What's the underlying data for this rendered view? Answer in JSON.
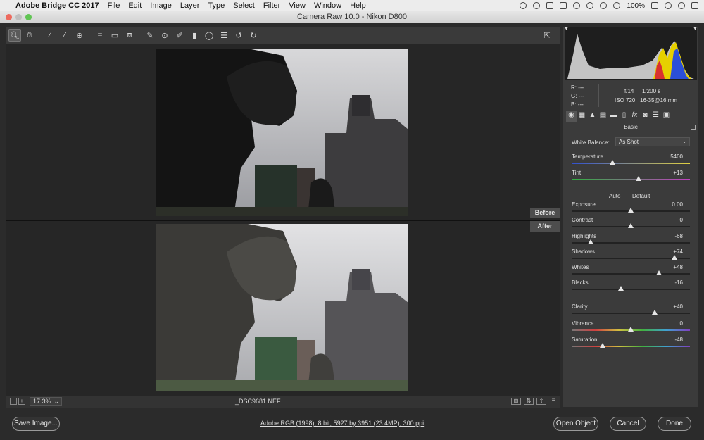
{
  "menubar": {
    "app_name": "Adobe Bridge CC 2017",
    "items": [
      "File",
      "Edit",
      "Image",
      "Layer",
      "Type",
      "Select",
      "Filter",
      "View",
      "Window",
      "Help"
    ],
    "battery": "100%"
  },
  "window": {
    "title": "Camera Raw 10.0  -  Nikon D800"
  },
  "preview": {
    "before_label": "Before",
    "after_label": "After"
  },
  "status": {
    "zoom": "17.3%",
    "filename": "_DSC9681.NEF"
  },
  "footer": {
    "save_label": "Save Image...",
    "workflow_link": "Adobe RGB (1998); 8 bit; 5927 by 3951 (23.4MP); 300 ppi",
    "open_label": "Open Object",
    "cancel_label": "Cancel",
    "done_label": "Done"
  },
  "info": {
    "r": "R:   ---",
    "g": "G:   ---",
    "b": "B:   ---",
    "aperture": "f/14",
    "shutter": "1/200 s",
    "iso": "ISO 720",
    "lens": "16-35@16 mm"
  },
  "panel": {
    "title": "Basic",
    "white_balance_label": "White Balance:",
    "white_balance_value": "As Shot",
    "auto_label": "Auto",
    "default_label": "Default",
    "sliders": [
      {
        "label": "Temperature",
        "value": "5400"
      },
      {
        "label": "Tint",
        "value": "+13"
      },
      {
        "label": "Exposure",
        "value": "0.00"
      },
      {
        "label": "Contrast",
        "value": "0"
      },
      {
        "label": "Highlights",
        "value": "-68"
      },
      {
        "label": "Shadows",
        "value": "+74"
      },
      {
        "label": "Whites",
        "value": "+48"
      },
      {
        "label": "Blacks",
        "value": "-16"
      },
      {
        "label": "Clarity",
        "value": "+40"
      },
      {
        "label": "Vibrance",
        "value": "0"
      },
      {
        "label": "Saturation",
        "value": "-48"
      }
    ]
  }
}
